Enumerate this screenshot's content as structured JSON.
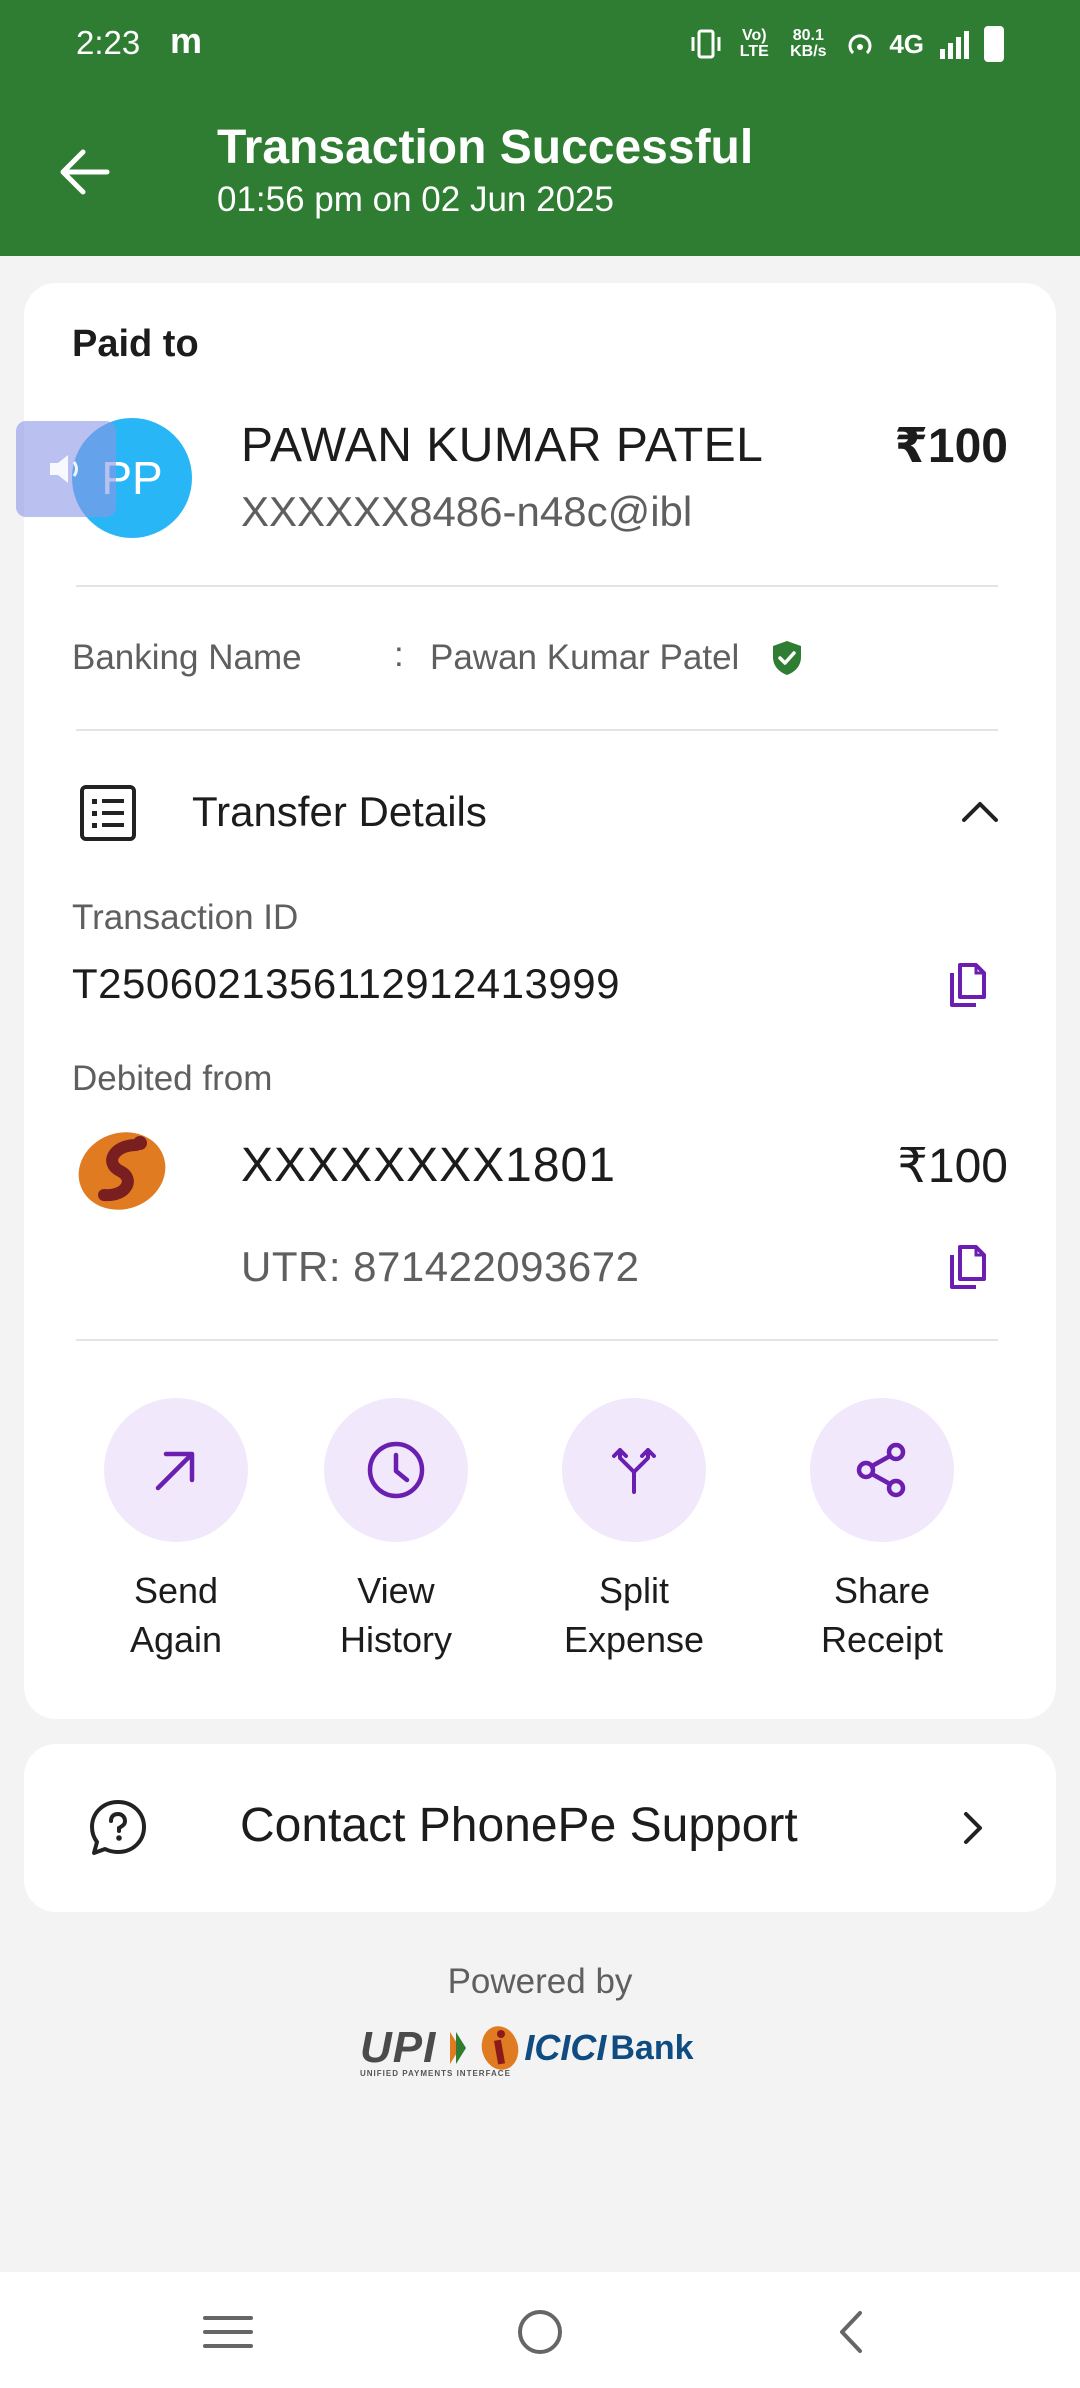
{
  "status_bar": {
    "time": "2:23",
    "notification": "m",
    "volte": "Vo) LTE",
    "speed": "80.1 KB/s",
    "network": "4G"
  },
  "header": {
    "title": "Transaction Successful",
    "subtitle": "01:56 pm on 02 Jun 2025",
    "bg_color": "#2e7d32"
  },
  "payee": {
    "section_label": "Paid to",
    "avatar_initials": "PP",
    "name": "PAWAN KUMAR PATEL",
    "vpa": "XXXXXX8486-n48c@ibl",
    "amount": "₹100",
    "banking_name_label": "Banking Name",
    "banking_name_colon": ":",
    "banking_name_value": "Pawan Kumar Patel"
  },
  "transfer": {
    "label": "Transfer Details",
    "transaction_id_label": "Transaction ID",
    "transaction_id": "T2506021356112912413999",
    "debited_from_label": "Debited from",
    "account": "XXXXXXXX1801",
    "amount": "₹100",
    "utr": "UTR: 871422093672"
  },
  "actions": [
    {
      "line1": "Send",
      "line2": "Again",
      "icon": "arrow-up-right-icon"
    },
    {
      "line1": "View",
      "line2": "History",
      "icon": "clock-icon"
    },
    {
      "line1": "Split",
      "line2": "Expense",
      "icon": "split-icon"
    },
    {
      "line1": "Share",
      "line2": "Receipt",
      "icon": "share-icon"
    }
  ],
  "support": {
    "label": "Contact PhonePe Support"
  },
  "footer": {
    "powered_by": "Powered by",
    "upi": "UPI",
    "upi_sub": "UNIFIED PAYMENTS INTERFACE",
    "bank_name": "ICICI",
    "bank_suffix": "Bank"
  },
  "colors": {
    "accent_purple": "#6a1fb0",
    "action_bg": "#f1e8fb",
    "verified_green": "#2e7d32"
  }
}
